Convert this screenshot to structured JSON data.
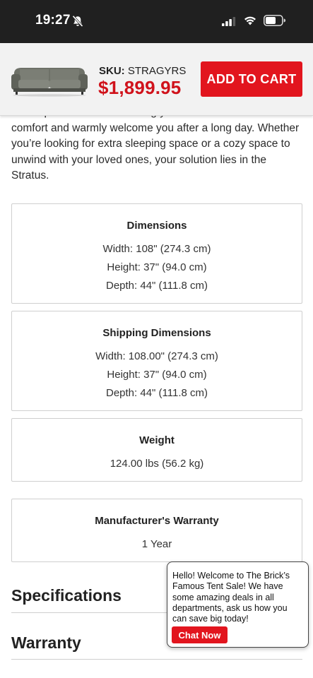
{
  "status_bar": {
    "time": "19:27",
    "icons": [
      "bell-slash-icon",
      "cellular-signal-icon",
      "wifi-icon",
      "battery-icon"
    ]
  },
  "sticky_header": {
    "product_thumbnail": "sofa-thumbnail",
    "sku_label": "SKU:",
    "sku_value": "STRAGYRS",
    "price": "$1,899.95",
    "add_to_cart_label": "ADD TO CART"
  },
  "description": {
    "text": "and super-soft fabric will bring you a sense of luxurious comfort and warmly welcome you after a long day. Whether you’re looking for extra sleeping space or a cozy space to unwind with your loved ones, your solution lies in the Stratus."
  },
  "dimensions": {
    "title": "Dimensions",
    "lines": [
      "Width: 108\" (274.3 cm)",
      "Height: 37\" (94.0 cm)",
      "Depth: 44\" (111.8 cm)"
    ]
  },
  "shipping_dimensions": {
    "title": "Shipping Dimensions",
    "lines": [
      "Width: 108.00\" (274.3 cm)",
      "Height: 37\" (94.0 cm)",
      "Depth: 44\" (111.8 cm)"
    ]
  },
  "weight": {
    "title": "Weight",
    "value": "124.00 lbs (56.2 kg)"
  },
  "manufacturer_warranty": {
    "title": "Manufacturer's Warranty",
    "value": "1 Year"
  },
  "sections": {
    "specifications": "Specifications",
    "warranty": "Warranty"
  },
  "chat": {
    "message": "Hello! Welcome to The Brick’s Famous Tent Sale! We have some amazing deals in all departments, ask us how you can save big today!",
    "button_label": "Chat Now"
  },
  "colors": {
    "brand_red": "#e2151e",
    "price_red": "#d0121b",
    "status_bar_bg": "#202020",
    "header_bg": "#f2f2f2"
  }
}
